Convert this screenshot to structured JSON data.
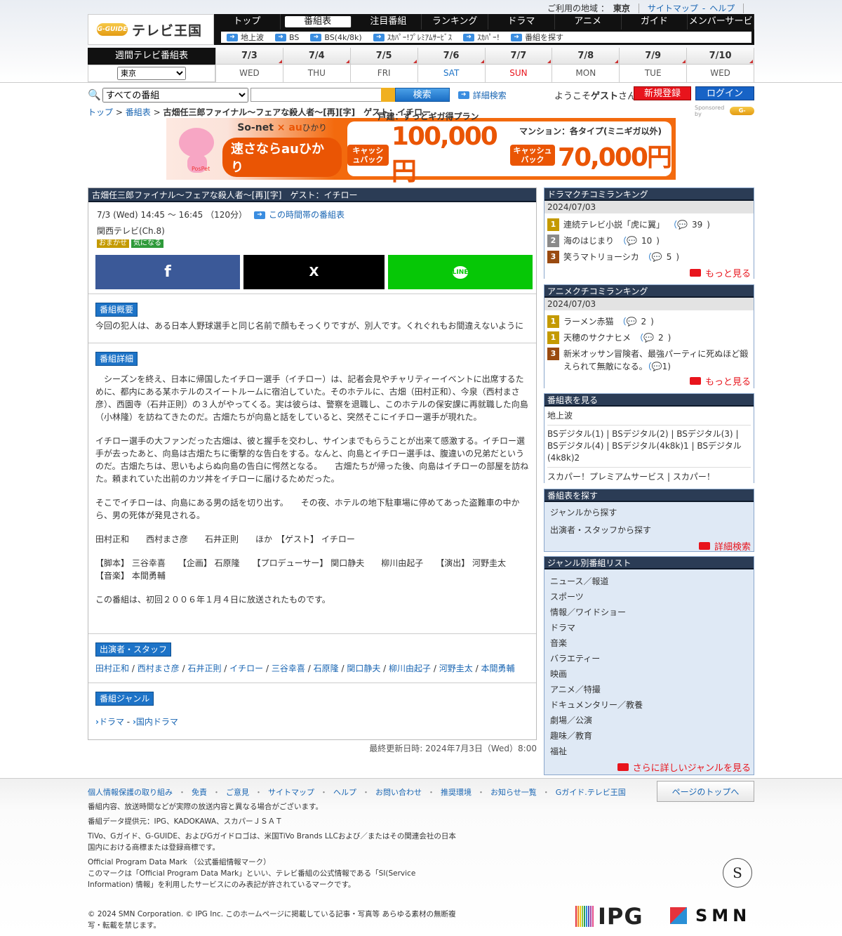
{
  "header": {
    "region_label": "ご利用の地域 ：",
    "region_value": "東京",
    "sitemap": "サイトマップ",
    "help": "ヘルプ",
    "link_sep": "-",
    "logo_badge": "G-GUIDE",
    "logo_text": "テレビ王国",
    "nav": [
      "トップ",
      "番組表",
      "注目番組",
      "ランキング",
      "ドラマ",
      "アニメ",
      "ガイド",
      "メンバーサービス"
    ],
    "subnav": [
      "地上波",
      "BS",
      "BS(4k/8k)",
      "ｽｶﾊﾟｰ!ﾌﾟﾚﾐｱﾑｻｰﾋﾞｽ",
      "ｽｶﾊﾟｰ!",
      "番組を探す"
    ],
    "week_label": "週間テレビ番組表",
    "area_select": "東京",
    "dates": [
      {
        "date": "7/3",
        "dow": "WED",
        "color": "#555555"
      },
      {
        "date": "7/4",
        "dow": "THU",
        "color": "#555555"
      },
      {
        "date": "7/5",
        "dow": "FRI",
        "color": "#555555"
      },
      {
        "date": "7/6",
        "dow": "SAT",
        "color": "#1d73c7"
      },
      {
        "date": "7/7",
        "dow": "SUN",
        "color": "#e8141c"
      },
      {
        "date": "7/8",
        "dow": "MON",
        "color": "#555555"
      },
      {
        "date": "7/9",
        "dow": "TUE",
        "color": "#555555"
      },
      {
        "date": "7/10",
        "dow": "WED",
        "color": "#555555"
      }
    ]
  },
  "search": {
    "scope": "すべての番組",
    "button": "検索",
    "detail": "詳細検索",
    "welcome_prefix": "ようこそ",
    "welcome_name": "ゲスト",
    "welcome_suffix": "さん",
    "register": "新規登録",
    "login": "ログイン"
  },
  "breadcrumb": {
    "top": "トップ",
    "sep": ">",
    "schedule": "番組表",
    "current": "古畑任三郎ファイナル～フェアな殺人者～[再][字]　ゲスト：イチロー",
    "sponsor_text": "Sponsored by",
    "sponsor_logo": "G-GUIDE"
  },
  "banner": {
    "brand1": "So-net",
    "times": "×",
    "brand2": "au",
    "brand2_suffix": "ひかり",
    "slogan": "速さならauひかり",
    "bear_name": "PosPet",
    "col1_title": "戸建：ずっとギガ得プラン",
    "col2_title": "マンション：各タイプ(ミニギガ以外)",
    "tag": "キャッシュバック",
    "amount1": "100,000円",
    "amount2": "70,000円"
  },
  "program": {
    "title": "古畑任三郎ファイナル～フェアな殺人者～[再][字]　ゲスト：イチロー",
    "datetime": "7/3 (Wed) 14:45 ～ 16:45 （120分）",
    "timeslot_link": "この時間帯の番組表",
    "channel": "関西テレビ(Ch.8)",
    "badges": [
      "おまかせ",
      "気になる"
    ],
    "social": [
      "f",
      "X",
      "LINE"
    ],
    "overview_title": "番組概要",
    "overview": "今回の犯人は、ある日本人野球選手と同じ名前で顔もそっくりですが、別人です。くれぐれもお間違えないように",
    "detail_title": "番組詳細",
    "detail_paragraphs": [
      "　シーズンを終え、日本に帰国したイチロー選手（イチロー）は、記者会見やチャリティーイベントに出席するために、都内にある某ホテルのスイートルームに宿泊していた。そのホテルに、古畑（田村正和）、今泉（西村まさ彦）、西園寺（石井正則）の３人がやってくる。実は彼らは、警察を退職し、このホテルの保安課に再就職した向島（小林隆）を訪ねてきたのだ。古畑たちが向島と話をしていると、突然そこにイチロー選手が現れた。",
      "イチロー選手の大ファンだった古畑は、彼と握手を交わし、サインまでもらうことが出来て感激する。イチロー選手が去ったあと、向島は古畑たちに衝撃的な告白をする。なんと、向島とイチロー選手は、腹違いの兄弟だというのだ。古畑たちは、思いもよらぬ向島の告白に愕然となる。　　古畑たちが帰った後、向島はイチローの部屋を訪ねた。頼まれていた出前のカツ丼をイチローに届けるためだった。",
      "そこでイチローは、向島にある男の話を切り出す。　　その夜、ホテルの地下駐車場に停めてあった盗難車の中から、男の死体が発見される。",
      "田村正和　　西村まさ彦　　石井正則　　ほか　【ゲスト】 イチロー",
      "【脚本】 三谷幸喜　　【企画】 石原隆　　【プロデューサー】 関口静夫　　柳川由起子　　【演出】 河野圭太　　【音楽】 本間勇輔",
      "この番組は、初回２００６年１月４日に放送されたものです。"
    ],
    "cast_title": "出演者・スタッフ",
    "cast": [
      "田村正和",
      "西村まさ彦",
      "石井正則",
      "イチロー",
      "三谷幸喜",
      "石原隆",
      "関口静夫",
      "柳川由起子",
      "河野圭太",
      "本間勇輔"
    ],
    "cast_sep": "/",
    "genre_title": "番組ジャンル",
    "genre1": "ドラマ",
    "genre_sep": "-",
    "genre2": "国内ドラマ",
    "updated": "最終更新日時: 2024年7月3日（Wed）8:00"
  },
  "sidebar": {
    "drama_title": "ドラマクチコミランキング",
    "drama_date": "2024/07/03",
    "drama": [
      {
        "rank": "1",
        "title": "連続テレビ小説「虎に翼」",
        "count": "39",
        "color": "#c49a00"
      },
      {
        "rank": "2",
        "title": "海のはじまり",
        "count": "10",
        "color": "#8a8a8a"
      },
      {
        "rank": "3",
        "title": "笑うマトリョーシカ",
        "count": "5",
        "color": "#9a4a10"
      }
    ],
    "anime_title": "アニメクチコミランキング",
    "anime_date": "2024/07/03",
    "anime": [
      {
        "rank": "1",
        "title": "ラーメン赤猫",
        "count": "2",
        "color": "#c49a00"
      },
      {
        "rank": "1",
        "title": "天穂のサクナヒメ",
        "count": "2",
        "color": "#c49a00"
      },
      {
        "rank": "3",
        "title": "新米オッサン冒険者、最強パーティに死ぬほど鍛えられて無敵になる。",
        "count": "1",
        "color": "#9a4a10"
      }
    ],
    "more": "もっと見る",
    "schedule_title": "番組表を見る",
    "terrestrial": "地上波",
    "bs_links": [
      "BSデジタル(1)",
      "BSデジタル(2)",
      "BSデジタル(3)",
      "BSデジタル(4)",
      "BSデジタル(4k8k)1",
      "BSデジタル(4k8k)2"
    ],
    "sky_links": [
      "スカパー！プレミアムサービス",
      "スカパー！"
    ],
    "link_sep": "|",
    "search_title": "番組表を探す",
    "search_links": [
      "ジャンルから探す",
      "出演者・スタッフから探す"
    ],
    "detail_search": "詳細検索",
    "genre_title": "ジャンル別番組リスト",
    "genres": [
      "ニュース／報道",
      "スポーツ",
      "情報／ワイドショー",
      "ドラマ",
      "音楽",
      "バラエティー",
      "映画",
      "アニメ／特撮",
      "ドキュメンタリー／教養",
      "劇場／公演",
      "趣味／教育",
      "福祉"
    ],
    "genre_more": "さらに詳しいジャンルを見る"
  },
  "footer": {
    "links": [
      "個人情報保護の取り組み",
      "免責",
      "ご意見",
      "サイトマップ",
      "ヘルプ",
      "お問い合わせ",
      "推奨環境",
      "お知らせ一覧",
      "Gガイド.テレビ王国"
    ],
    "dot": "・",
    "to_top": "ページのトップへ",
    "note1": "番組内容、放送時間などが実際の放送内容と異なる場合がございます。",
    "note2": "番組データ提供元：IPG、KADOKAWA、スカパーＪＳＡＴ",
    "note3a": "TiVo、Gガイド、G-GUIDE、およびGガイドロゴは、米国TiVo Brands LLCおよび／またはその関連会社の日本",
    "note3b": "国内における商標または登録商標です。",
    "note4a": "Official Program Data Mark （公式番組情報マーク）",
    "note4b": "このマークは「Official Program Data Mark」といい、テレビ番組の公式情報である「SI(Service",
    "note4c": "Information) 情報」を利用したサービスにのみ表記が許されているマークです。",
    "copy1": "© 2024 SMN Corporation. © IPG Inc. このホームページに掲載している記事・写真等 あらゆる素材の無断複",
    "copy2": "写・転載を禁じます。",
    "seal": "S",
    "ipg": "IPG",
    "smn": "SMN"
  }
}
